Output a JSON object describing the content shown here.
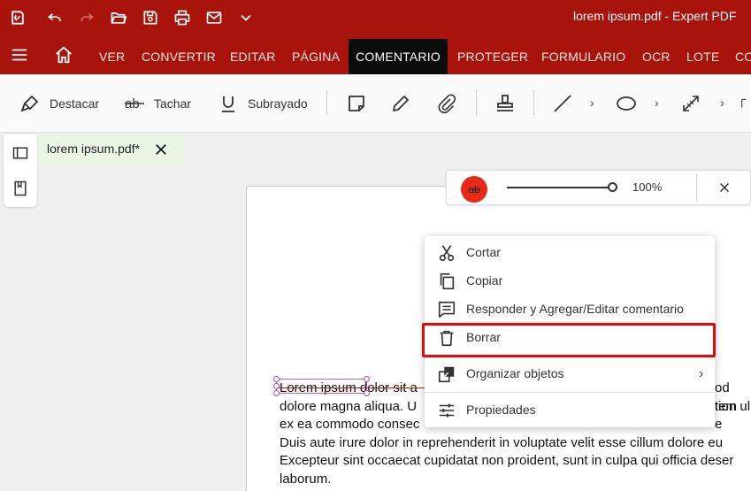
{
  "titlebar": {
    "title": "lorem ipsum.pdf   -   Expert PDF",
    "icons": [
      "app-logo-icon",
      "undo-icon",
      "redo-icon",
      "open-folder-icon",
      "save-icon",
      "print-icon",
      "mail-icon",
      "chevron-down-icon"
    ]
  },
  "menubar": {
    "items": [
      "VER",
      "CONVERTIR",
      "EDITAR",
      "PÁGINA",
      "COMENTARIO",
      "PROTEGER",
      "FORMULARIO",
      "OCR",
      "LOTE",
      "CO"
    ],
    "active": "COMENTARIO"
  },
  "toolbar": {
    "highlight_label": "Destacar",
    "strikethrough_label": "Tachar",
    "underline_label": "Subrayado"
  },
  "doctab": {
    "name": "lorem ipsum.pdf*"
  },
  "propbar": {
    "badge_text": "ab",
    "zoom": "100%"
  },
  "document": {
    "lines": [
      "Lorem ipsum dolor sit a",
      "dolore magna aliqua. U",
      "ex ea commodo consec",
      "Duis aute irure dolor in reprehenderit in voluptate velit esse cillum dolore eu",
      "Excepteur sint occaecat cupidatat non proident, sunt in culpa qui officia deser",
      "laborum."
    ],
    "right_fragments": [
      "od tem",
      "tion ul",
      "e"
    ]
  },
  "context_menu": {
    "items": [
      {
        "label": "Cortar",
        "icon": "scissors-icon"
      },
      {
        "label": "Copiar",
        "icon": "copy-icon"
      },
      {
        "label": "Responder y Agregar/Editar comentario",
        "icon": "comment-icon"
      },
      {
        "label": "Borrar",
        "icon": "trash-icon"
      },
      {
        "label": "Organizar objetos",
        "icon": "arrange-icon",
        "submenu": "›"
      },
      {
        "label": "Propiedades",
        "icon": "sliders-icon"
      }
    ]
  },
  "colors": {
    "titlebar": "#a8140c",
    "active_tab": "#0c0c0c",
    "highlight_border": "#e30a0a",
    "badge": "#ea2a18"
  }
}
